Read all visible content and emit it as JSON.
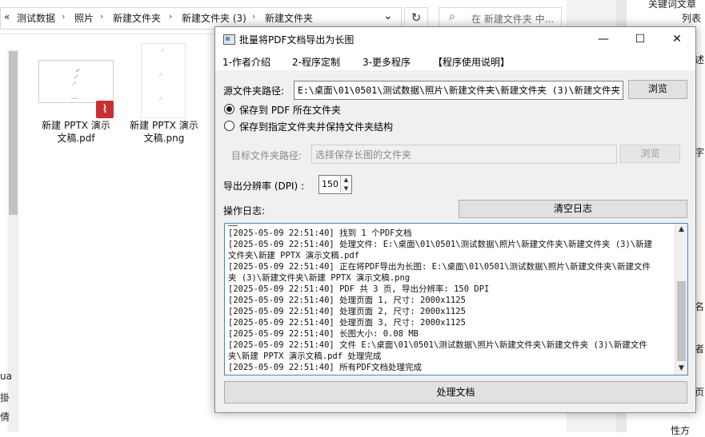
{
  "explorer": {
    "back_chevron": "«",
    "breadcrumb": [
      "测试数据",
      "照片",
      "新建文件夹",
      "新建文件夹 (3)",
      "新建文件夹"
    ],
    "breadcrumb_sep": "›",
    "dropdown": "⌄",
    "refresh": "↻",
    "search_placeholder": "在 新建文件夹 中...",
    "files": [
      {
        "name_line1": "新建 PPTX 演示",
        "name_line2": "文稿.pdf",
        "type": "pdf"
      },
      {
        "name_line1": "新建 PPTX 演示",
        "name_line2": "文稿.png",
        "type": "png"
      }
    ],
    "left_fragments": [
      "ua",
      "掛",
      "倩"
    ]
  },
  "right_window": {
    "lines": [
      "关键词文章",
      "列表",
      "述",
      "字",
      "名",
      "者",
      "页",
      "性方"
    ]
  },
  "dialog": {
    "title": "批量将PDF文档导出为长图",
    "controls": {
      "minimize": "—",
      "maximize": "☐",
      "close": "✕"
    },
    "menu": [
      "1-作者介绍",
      "2-程序定制",
      "3-更多程序",
      "【程序使用说明】"
    ],
    "source_label": "源文件夹路径:",
    "source_path": "E:\\桌面\\01\\0501\\测试数据\\照片\\新建文件夹\\新建文件夹 (3)\\新建文件夹",
    "browse_label": "浏览",
    "radio_options": [
      {
        "label": "保存到 PDF 所在文件夹",
        "checked": true
      },
      {
        "label": "保存到指定文件夹并保持文件夹结构",
        "checked": false
      }
    ],
    "target_label": "目标文件夹路径:",
    "target_placeholder": "选择保存长图的文件夹",
    "target_browse_label": "浏览",
    "dpi_label": "导出分辨率 (DPI) :",
    "dpi_value": "150",
    "log_label": "操作日志:",
    "clear_log_label": "清空日志",
    "log_lines": [
      "[2025-05-09 22:51:40] 找到 1 个PDF文档",
      "[2025-05-09 22:51:40] 处理文件: E:\\桌面\\01\\0501\\测试数据\\照片\\新建文件夹\\新建文件夹 (3)\\新建",
      "文件夹\\新建 PPTX 演示文稿.pdf",
      "[2025-05-09 22:51:40] 正在将PDF导出为长图: E:\\桌面\\01\\0501\\测试数据\\照片\\新建文件夹\\新建文件",
      "夹 (3)\\新建文件夹\\新建 PPTX 演示文稿.png",
      "[2025-05-09 22:51:40] PDF 共 3 页, 导出分辨率: 150 DPI",
      "[2025-05-09 22:51:40] 处理页面 1, 尺寸: 2000x1125",
      "[2025-05-09 22:51:40] 处理页面 2, 尺寸: 2000x1125",
      "[2025-05-09 22:51:40] 处理页面 3, 尺寸: 2000x1125",
      "[2025-05-09 22:51:40] 长图大小: 0.08 MB",
      "[2025-05-09 22:51:40] 文件 E:\\桌面\\01\\0501\\测试数据\\照片\\新建文件夹\\新建文件夹 (3)\\新建文件",
      "夹\\新建 PPTX 演示文稿.pdf 处理完成",
      "[2025-05-09 22:51:40] 所有PDF文档处理完成"
    ],
    "process_label": "处理文档"
  }
}
